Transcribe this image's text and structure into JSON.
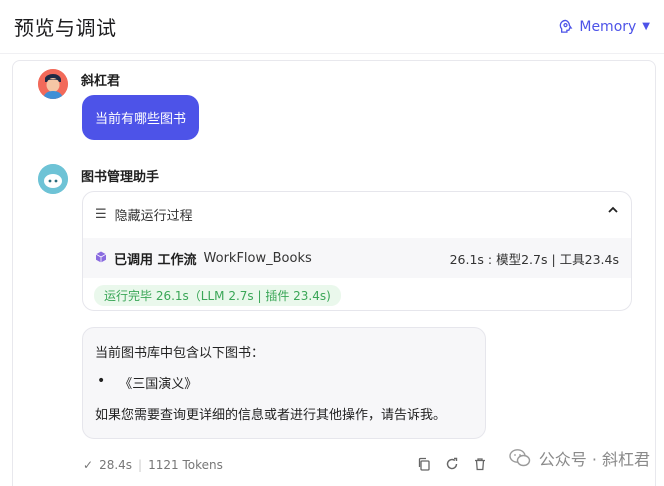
{
  "header": {
    "title": "预览与调试",
    "memory_label": "Memory",
    "accent": "#4d53e8"
  },
  "conversation": {
    "user": {
      "name": "斜杠君",
      "avatar_icon": "user-avatar",
      "message": "当前有哪些图书"
    },
    "bot": {
      "name": "图书管理助手",
      "avatar_icon": "bot-avatar",
      "process": {
        "toggle_label": "隐藏运行过程",
        "tool": {
          "called_label": "已调用 工作流",
          "workflow_name": "WorkFlow_Books",
          "timing": "26.1s : 模型2.7s | 工具23.4s"
        },
        "status": "运行完毕 26.1s（LLM 2.7s | 插件 23.4s)"
      },
      "answer": {
        "intro": "当前图书库中包含以下图书：",
        "items": [
          "《三国演义》"
        ],
        "outro": "如果您需要查询更详细的信息或者进行其他操作，请告诉我。"
      },
      "footer": {
        "duration": "28.4s",
        "tokens": "1121 Tokens"
      }
    }
  },
  "watermark": {
    "text": "公众号 · 斜杠君"
  }
}
